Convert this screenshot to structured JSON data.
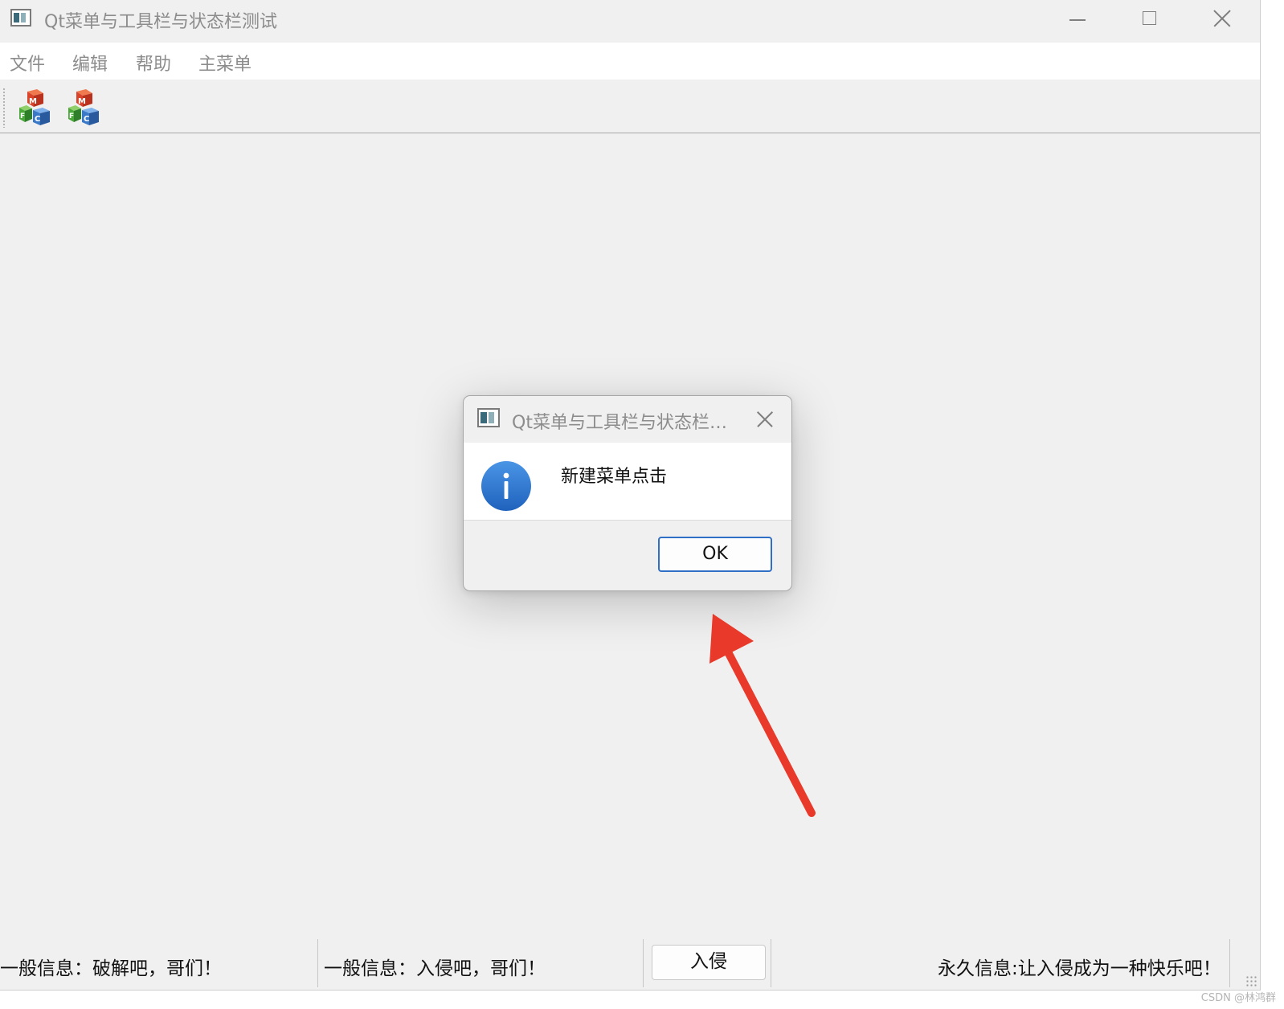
{
  "window": {
    "title": "Qt菜单与工具栏与状态栏测试"
  },
  "menubar": {
    "items": [
      {
        "label": "文件"
      },
      {
        "label": "编辑"
      },
      {
        "label": "帮助"
      },
      {
        "label": "主菜单"
      }
    ]
  },
  "toolbar": {
    "buttons": [
      {
        "icon": "mfc-cubes-icon"
      },
      {
        "icon": "mfc-cubes-icon"
      }
    ]
  },
  "dialog": {
    "title": "Qt菜单与工具栏与状态栏测试",
    "icon": "information-icon",
    "message": "新建菜单点击",
    "ok_label": "OK"
  },
  "statusbar": {
    "message_1": "一般信息：破解吧，哥们！",
    "message_2": "一般信息：入侵吧，哥们！",
    "button_label": "入侵",
    "permanent_message": "永久信息:让入侵成为一种快乐吧！"
  },
  "annotation": {
    "arrow_color": "#e8392a"
  },
  "watermark": {
    "text": "CSDN @林鸿群"
  },
  "colors": {
    "window_background": "#f0f0f0",
    "dialog_button_border": "#2f6fc6",
    "info_icon": "#2e7bd3"
  }
}
